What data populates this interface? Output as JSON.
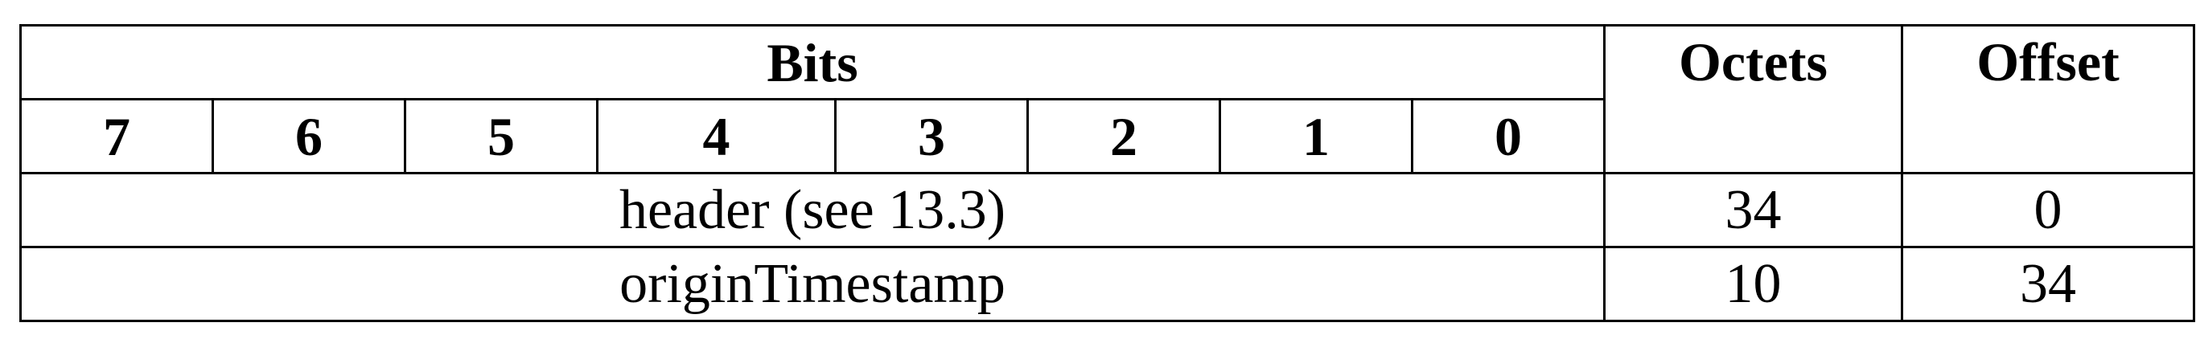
{
  "table": {
    "headers": {
      "bits": "Bits",
      "octets": "Octets",
      "offset": "Offset"
    },
    "bit_labels": [
      "7",
      "6",
      "5",
      "4",
      "3",
      "2",
      "1",
      "0"
    ],
    "rows": [
      {
        "field": "header (see 13.3)",
        "octets": "34",
        "offset": "0"
      },
      {
        "field": "originTimestamp",
        "octets": "10",
        "offset": "34"
      }
    ]
  }
}
